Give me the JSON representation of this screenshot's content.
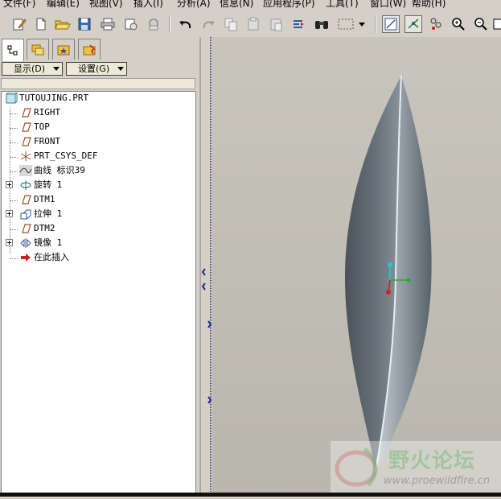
{
  "menu": [
    "文件(F)",
    "编辑(E)",
    "视图(V)",
    "插入(I)",
    "分析(A)",
    "信息(N)",
    "应用程序(P)",
    "工具(T)",
    "窗口(W)",
    "帮助(H)"
  ],
  "panel": {
    "display_label": "显示(D)",
    "settings_label": "设置(G)"
  },
  "tree": {
    "items": [
      {
        "label": "TUTOUJING.PRT",
        "icon": "part-icon"
      },
      {
        "label": "RIGHT",
        "icon": "datum-plane-icon"
      },
      {
        "label": "TOP",
        "icon": "datum-plane-icon"
      },
      {
        "label": "FRONT",
        "icon": "datum-plane-icon"
      },
      {
        "label": "PRT_CSYS_DEF",
        "icon": "csys-icon"
      },
      {
        "label": "曲线 标识39",
        "icon": "curve-icon"
      },
      {
        "label": "旋转 1",
        "icon": "revolve-icon"
      },
      {
        "label": "DTM1",
        "icon": "datum-plane-icon"
      },
      {
        "label": "拉伸 1",
        "icon": "extrude-icon"
      },
      {
        "label": "DTM2",
        "icon": "datum-plane-icon"
      },
      {
        "label": "镜像 1",
        "icon": "mirror-icon"
      },
      {
        "label": "在此插入",
        "icon": "insert-arrow-icon"
      }
    ]
  },
  "watermark": {
    "title": "野火论坛",
    "url": "www.proewildfire.cn"
  },
  "colors": {
    "model": "#5f6870",
    "accent_red": "#cc1f1f",
    "axis_cyan": "#22c8d8",
    "axis_green": "#22b022"
  }
}
